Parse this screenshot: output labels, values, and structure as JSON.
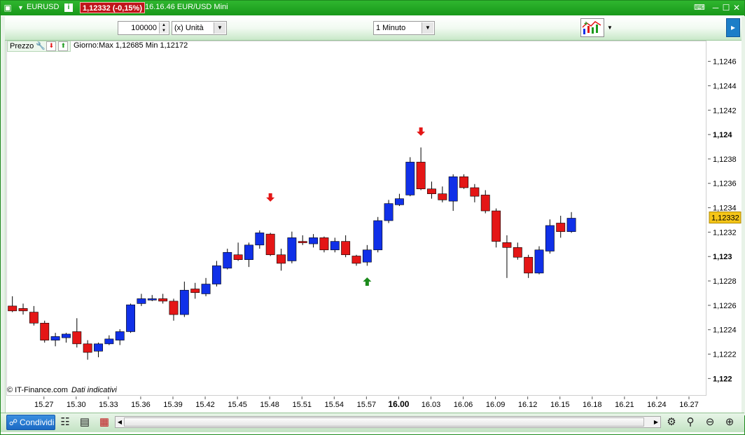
{
  "window": {
    "symbol": "EURUSD",
    "price_badge": "1,12332 (-0,15%)",
    "time_title": "16.16.46 EUR/USD Mini"
  },
  "toolbar": {
    "quantity": "100000",
    "unit_select": "(x) Unità",
    "timeframe_select": "1 Minuto"
  },
  "chart_header": {
    "prezzo_label": "Prezzo",
    "range_info": "Giorno:Max 1,12685 Min 1,12172"
  },
  "footnote": {
    "copyright": "© IT-Finance.com",
    "note": "Dati indicativi"
  },
  "bottom_bar": {
    "share_label": "Condividi"
  },
  "colors": {
    "up_candle": "#1030e8",
    "down_candle": "#e41616",
    "title_green": "#22a822",
    "price_marker": "#f5c518"
  },
  "chart_data": {
    "type": "candlestick",
    "current_price_label": "1,12332",
    "ylim": [
      1.12187,
      1.12477
    ],
    "y_ticks": [
      {
        "value": 1.1246,
        "label": "1,1246",
        "bold": false
      },
      {
        "value": 1.1244,
        "label": "1,1244",
        "bold": false
      },
      {
        "value": 1.1242,
        "label": "1,1242",
        "bold": false
      },
      {
        "value": 1.124,
        "label": "1,124",
        "bold": true
      },
      {
        "value": 1.1238,
        "label": "1,1238",
        "bold": false
      },
      {
        "value": 1.1236,
        "label": "1,1236",
        "bold": false
      },
      {
        "value": 1.1234,
        "label": "1,1234",
        "bold": false
      },
      {
        "value": 1.1232,
        "label": "1,1232",
        "bold": false
      },
      {
        "value": 1.123,
        "label": "1,123",
        "bold": true
      },
      {
        "value": 1.1228,
        "label": "1,1228",
        "bold": false
      },
      {
        "value": 1.1226,
        "label": "1,1226",
        "bold": false
      },
      {
        "value": 1.1224,
        "label": "1,1224",
        "bold": false
      },
      {
        "value": 1.1222,
        "label": "1,1222",
        "bold": false
      },
      {
        "value": 1.122,
        "label": "1,122",
        "bold": true
      }
    ],
    "x_ticks": [
      {
        "label": "15.27",
        "index": 3,
        "bold": false
      },
      {
        "label": "15.30",
        "index": 6,
        "bold": false
      },
      {
        "label": "15.33",
        "index": 9,
        "bold": false
      },
      {
        "label": "15.36",
        "index": 12,
        "bold": false
      },
      {
        "label": "15.39",
        "index": 15,
        "bold": false
      },
      {
        "label": "15.42",
        "index": 18,
        "bold": false
      },
      {
        "label": "15.45",
        "index": 21,
        "bold": false
      },
      {
        "label": "15.48",
        "index": 24,
        "bold": false
      },
      {
        "label": "15.51",
        "index": 27,
        "bold": false
      },
      {
        "label": "15.54",
        "index": 30,
        "bold": false
      },
      {
        "label": "15.57",
        "index": 33,
        "bold": false
      },
      {
        "label": "16.00",
        "index": 36,
        "bold": true
      },
      {
        "label": "16.03",
        "index": 39,
        "bold": false
      },
      {
        "label": "16.06",
        "index": 42,
        "bold": false
      },
      {
        "label": "16.09",
        "index": 45,
        "bold": false
      },
      {
        "label": "16.12",
        "index": 48,
        "bold": false
      },
      {
        "label": "16.15",
        "index": 51,
        "bold": false
      },
      {
        "label": "16.18",
        "index": 54,
        "bold": false
      },
      {
        "label": "16.21",
        "index": 57,
        "bold": false
      },
      {
        "label": "16.24",
        "index": 60,
        "bold": false
      },
      {
        "label": "16.27",
        "index": 63,
        "bold": false
      }
    ],
    "x_first_index": 0,
    "x_last_index": 64,
    "candles": [
      {
        "o": 1.1226,
        "h": 1.12268,
        "l": 1.12255,
        "c": 1.12256
      },
      {
        "o": 1.12258,
        "h": 1.12262,
        "l": 1.12253,
        "c": 1.12256
      },
      {
        "o": 1.12255,
        "h": 1.1226,
        "l": 1.12244,
        "c": 1.12246
      },
      {
        "o": 1.12246,
        "h": 1.12248,
        "l": 1.1223,
        "c": 1.12232
      },
      {
        "o": 1.12232,
        "h": 1.12238,
        "l": 1.12227,
        "c": 1.12235
      },
      {
        "o": 1.12234,
        "h": 1.12238,
        "l": 1.1223,
        "c": 1.12237
      },
      {
        "o": 1.12239,
        "h": 1.1225,
        "l": 1.12226,
        "c": 1.12229
      },
      {
        "o": 1.12229,
        "h": 1.12232,
        "l": 1.12216,
        "c": 1.12222
      },
      {
        "o": 1.12223,
        "h": 1.1223,
        "l": 1.12218,
        "c": 1.12229
      },
      {
        "o": 1.12229,
        "h": 1.12236,
        "l": 1.12228,
        "c": 1.12233
      },
      {
        "o": 1.12232,
        "h": 1.12241,
        "l": 1.12228,
        "c": 1.12239
      },
      {
        "o": 1.12239,
        "h": 1.12262,
        "l": 1.12238,
        "c": 1.12261
      },
      {
        "o": 1.12262,
        "h": 1.1227,
        "l": 1.1226,
        "c": 1.12266
      },
      {
        "o": 1.12266,
        "h": 1.12269,
        "l": 1.12264,
        "c": 1.12266
      },
      {
        "o": 1.12266,
        "h": 1.1227,
        "l": 1.12262,
        "c": 1.12264
      },
      {
        "o": 1.12264,
        "h": 1.12266,
        "l": 1.12248,
        "c": 1.12253
      },
      {
        "o": 1.12253,
        "h": 1.1228,
        "l": 1.12251,
        "c": 1.12273
      },
      {
        "o": 1.12274,
        "h": 1.12279,
        "l": 1.12266,
        "c": 1.12271
      },
      {
        "o": 1.1227,
        "h": 1.12283,
        "l": 1.12268,
        "c": 1.12278
      },
      {
        "o": 1.12278,
        "h": 1.12297,
        "l": 1.12276,
        "c": 1.12293
      },
      {
        "o": 1.12291,
        "h": 1.12307,
        "l": 1.1229,
        "c": 1.12304
      },
      {
        "o": 1.12302,
        "h": 1.12312,
        "l": 1.12297,
        "c": 1.12298
      },
      {
        "o": 1.12298,
        "h": 1.12312,
        "l": 1.12292,
        "c": 1.1231
      },
      {
        "o": 1.1231,
        "h": 1.12322,
        "l": 1.12307,
        "c": 1.1232
      },
      {
        "o": 1.12319,
        "h": 1.1232,
        "l": 1.12301,
        "c": 1.12302
      },
      {
        "o": 1.12302,
        "h": 1.12307,
        "l": 1.12289,
        "c": 1.12295
      },
      {
        "o": 1.12297,
        "h": 1.12321,
        "l": 1.12295,
        "c": 1.12316
      },
      {
        "o": 1.12313,
        "h": 1.12318,
        "l": 1.1231,
        "c": 1.12312
      },
      {
        "o": 1.12311,
        "h": 1.12319,
        "l": 1.12308,
        "c": 1.12316
      },
      {
        "o": 1.12316,
        "h": 1.12317,
        "l": 1.12304,
        "c": 1.12306
      },
      {
        "o": 1.12306,
        "h": 1.12316,
        "l": 1.12304,
        "c": 1.12313
      },
      {
        "o": 1.12313,
        "h": 1.12318,
        "l": 1.123,
        "c": 1.12302
      },
      {
        "o": 1.12301,
        "h": 1.12302,
        "l": 1.12293,
        "c": 1.12295
      },
      {
        "o": 1.12296,
        "h": 1.1231,
        "l": 1.12293,
        "c": 1.12306
      },
      {
        "o": 1.12306,
        "h": 1.12333,
        "l": 1.12304,
        "c": 1.1233
      },
      {
        "o": 1.1233,
        "h": 1.12347,
        "l": 1.12328,
        "c": 1.12344
      },
      {
        "o": 1.12343,
        "h": 1.12352,
        "l": 1.12342,
        "c": 1.12348
      },
      {
        "o": 1.12351,
        "h": 1.12382,
        "l": 1.1235,
        "c": 1.12378
      },
      {
        "o": 1.12378,
        "h": 1.1239,
        "l": 1.12355,
        "c": 1.12356
      },
      {
        "o": 1.12356,
        "h": 1.12362,
        "l": 1.12348,
        "c": 1.12352
      },
      {
        "o": 1.12352,
        "h": 1.12358,
        "l": 1.12345,
        "c": 1.12347
      },
      {
        "o": 1.12346,
        "h": 1.12368,
        "l": 1.12338,
        "c": 1.12366
      },
      {
        "o": 1.12366,
        "h": 1.12368,
        "l": 1.12356,
        "c": 1.12357
      },
      {
        "o": 1.12357,
        "h": 1.1236,
        "l": 1.12345,
        "c": 1.1235
      },
      {
        "o": 1.12351,
        "h": 1.12355,
        "l": 1.12336,
        "c": 1.12338
      },
      {
        "o": 1.12338,
        "h": 1.1234,
        "l": 1.12308,
        "c": 1.12313
      },
      {
        "o": 1.12312,
        "h": 1.12318,
        "l": 1.12283,
        "c": 1.12308
      },
      {
        "o": 1.12308,
        "h": 1.12312,
        "l": 1.12298,
        "c": 1.123
      },
      {
        "o": 1.123,
        "h": 1.12302,
        "l": 1.12283,
        "c": 1.12287
      },
      {
        "o": 1.12287,
        "h": 1.12309,
        "l": 1.12286,
        "c": 1.12306
      },
      {
        "o": 1.12305,
        "h": 1.12331,
        "l": 1.12303,
        "c": 1.12326
      },
      {
        "o": 1.12328,
        "h": 1.12334,
        "l": 1.12316,
        "c": 1.12321
      },
      {
        "o": 1.12321,
        "h": 1.12337,
        "l": 1.1232,
        "c": 1.12332
      }
    ],
    "signals": [
      {
        "index": 24,
        "type": "sell",
        "price": 1.12349
      },
      {
        "index": 33,
        "type": "buy",
        "price": 1.1228
      },
      {
        "index": 38,
        "type": "sell",
        "price": 1.12403
      }
    ]
  }
}
